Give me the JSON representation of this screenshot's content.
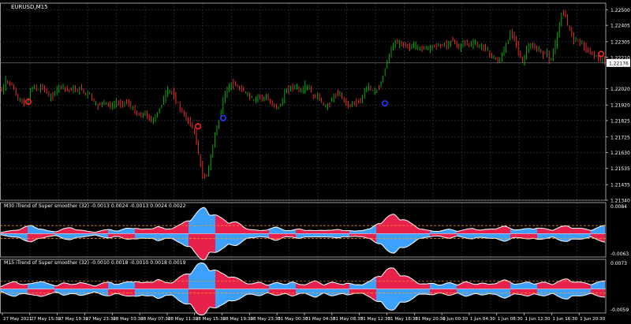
{
  "window": {
    "title": "EURUSD,M15"
  },
  "main_panel": {
    "price_labels": [
      "1.22500",
      "1.22405",
      "1.22305",
      "1.22210",
      "1.22020",
      "1.21920",
      "1.21825",
      "1.21725",
      "1.21630",
      "1.21535",
      "1.21435",
      "1.21340"
    ],
    "current_price": "1.22176",
    "price_range": [
      1.2134,
      1.2254
    ],
    "price_path": [
      [
        0,
        1.2203
      ],
      [
        5,
        1.22
      ],
      [
        10,
        1.2207
      ],
      [
        15,
        1.2205
      ],
      [
        20,
        1.2202
      ],
      [
        25,
        1.2196
      ],
      [
        30,
        1.2194
      ],
      [
        35,
        1.2192
      ],
      [
        40,
        1.2198
      ],
      [
        45,
        1.2205
      ],
      [
        50,
        1.22
      ],
      [
        55,
        1.2204
      ],
      [
        60,
        1.2201
      ],
      [
        65,
        1.2196
      ],
      [
        70,
        1.2198
      ],
      [
        75,
        1.2202
      ],
      [
        80,
        1.2204
      ],
      [
        85,
        1.2202
      ],
      [
        90,
        1.2201
      ],
      [
        95,
        1.2202
      ],
      [
        100,
        1.22
      ],
      [
        105,
        1.2203
      ],
      [
        110,
        1.2198
      ],
      [
        115,
        1.22
      ],
      [
        120,
        1.2195
      ],
      [
        125,
        1.2191
      ],
      [
        130,
        1.2193
      ],
      [
        135,
        1.2194
      ],
      [
        140,
        1.2192
      ],
      [
        145,
        1.2191
      ],
      [
        150,
        1.2194
      ],
      [
        155,
        1.2192
      ],
      [
        160,
        1.2194
      ],
      [
        165,
        1.2193
      ],
      [
        170,
        1.219
      ],
      [
        175,
        1.2187
      ],
      [
        180,
        1.2185
      ],
      [
        185,
        1.2187
      ],
      [
        190,
        1.2185
      ],
      [
        195,
        1.2182
      ],
      [
        200,
        1.2185
      ],
      [
        205,
        1.219
      ],
      [
        210,
        1.2196
      ],
      [
        215,
        1.2201
      ],
      [
        220,
        1.22
      ],
      [
        225,
        1.2195
      ],
      [
        230,
        1.2191
      ],
      [
        235,
        1.2186
      ],
      [
        240,
        1.2183
      ],
      [
        245,
        1.218
      ],
      [
        250,
        1.2174
      ],
      [
        255,
        1.216
      ],
      [
        260,
        1.2147
      ],
      [
        265,
        1.215
      ],
      [
        270,
        1.216
      ],
      [
        275,
        1.2175
      ],
      [
        280,
        1.2182
      ],
      [
        285,
        1.2194
      ],
      [
        290,
        1.2201
      ],
      [
        295,
        1.2205
      ],
      [
        300,
        1.2204
      ],
      [
        305,
        1.2202
      ],
      [
        310,
        1.2201
      ],
      [
        315,
        1.2199
      ],
      [
        320,
        1.2197
      ],
      [
        325,
        1.2194
      ],
      [
        330,
        1.2198
      ],
      [
        335,
        1.2196
      ],
      [
        340,
        1.2197
      ],
      [
        345,
        1.2193
      ],
      [
        350,
        1.2192
      ],
      [
        355,
        1.219
      ],
      [
        360,
        1.2194
      ],
      [
        365,
        1.2201
      ],
      [
        370,
        1.2202
      ],
      [
        375,
        1.2204
      ],
      [
        380,
        1.2202
      ],
      [
        385,
        1.22
      ],
      [
        390,
        1.2204
      ],
      [
        395,
        1.2202
      ],
      [
        400,
        1.2196
      ],
      [
        405,
        1.2198
      ],
      [
        410,
        1.2194
      ],
      [
        415,
        1.219
      ],
      [
        420,
        1.2193
      ],
      [
        425,
        1.2197
      ],
      [
        430,
        1.2199
      ],
      [
        435,
        1.2198
      ],
      [
        440,
        1.2194
      ],
      [
        445,
        1.2191
      ],
      [
        450,
        1.2194
      ],
      [
        455,
        1.2193
      ],
      [
        460,
        1.2194
      ],
      [
        465,
        1.2201
      ],
      [
        470,
        1.2204
      ],
      [
        475,
        1.22
      ],
      [
        480,
        1.2201
      ],
      [
        485,
        1.2204
      ],
      [
        490,
        1.2213
      ],
      [
        495,
        1.2221
      ],
      [
        500,
        1.2228
      ],
      [
        505,
        1.223
      ],
      [
        510,
        1.2229
      ],
      [
        515,
        1.2229
      ],
      [
        520,
        1.2227
      ],
      [
        525,
        1.2228
      ],
      [
        530,
        1.2228
      ],
      [
        535,
        1.2226
      ],
      [
        540,
        1.2227
      ],
      [
        545,
        1.2227
      ],
      [
        550,
        1.2227
      ],
      [
        555,
        1.2229
      ],
      [
        560,
        1.2227
      ],
      [
        565,
        1.223
      ],
      [
        570,
        1.2227
      ],
      [
        575,
        1.2232
      ],
      [
        580,
        1.223
      ],
      [
        585,
        1.2226
      ],
      [
        590,
        1.2231
      ],
      [
        595,
        1.2229
      ],
      [
        600,
        1.2229
      ],
      [
        605,
        1.223
      ],
      [
        610,
        1.2227
      ],
      [
        615,
        1.2228
      ],
      [
        620,
        1.2225
      ],
      [
        625,
        1.2222
      ],
      [
        630,
        1.222
      ],
      [
        635,
        1.2218
      ],
      [
        640,
        1.2224
      ],
      [
        645,
        1.2229
      ],
      [
        650,
        1.2237
      ],
      [
        655,
        1.2233
      ],
      [
        660,
        1.2224
      ],
      [
        665,
        1.2217
      ],
      [
        670,
        1.2226
      ],
      [
        675,
        1.2229
      ],
      [
        680,
        1.2226
      ],
      [
        685,
        1.2226
      ],
      [
        690,
        1.2222
      ],
      [
        695,
        1.2225
      ],
      [
        700,
        1.2218
      ],
      [
        705,
        1.2226
      ],
      [
        710,
        1.2236
      ],
      [
        715,
        1.2249
      ],
      [
        720,
        1.2245
      ],
      [
        725,
        1.2237
      ],
      [
        730,
        1.2232
      ],
      [
        735,
        1.2232
      ],
      [
        740,
        1.2229
      ],
      [
        745,
        1.2227
      ],
      [
        750,
        1.2224
      ],
      [
        755,
        1.2223
      ],
      [
        760,
        1.2221
      ],
      [
        765,
        1.2219
      ],
      [
        768,
        1.2218
      ]
    ],
    "blue_markers": [
      [
        283,
        1.2184
      ],
      [
        488,
        1.2193
      ]
    ],
    "red_markers": [
      [
        36,
        1.2194
      ],
      [
        251,
        1.2179
      ],
      [
        762,
        1.2223
      ]
    ]
  },
  "indicator_panels": [
    {
      "label": "M30 iTrend of Super smoother (32) -0.0013 0.0024 -0.0013 0.0024 0.0022",
      "axis_labels": [
        "0.0084",
        "-0.0063"
      ],
      "range": [
        -0.0063,
        0.0084
      ],
      "guide_levels": [
        0.0022,
        -0.0013
      ],
      "amplitude_path": [
        [
          0,
          0.0003
        ],
        [
          10,
          0.0006
        ],
        [
          20,
          0.0009
        ],
        [
          30,
          0.0016
        ],
        [
          40,
          0.002
        ],
        [
          50,
          0.0014
        ],
        [
          60,
          0.0007
        ],
        [
          70,
          0.0005
        ],
        [
          80,
          0.0012
        ],
        [
          90,
          0.0015
        ],
        [
          100,
          0.001
        ],
        [
          110,
          0.0006
        ],
        [
          120,
          0.0004
        ],
        [
          130,
          0.0008
        ],
        [
          140,
          0.0011
        ],
        [
          150,
          0.0007
        ],
        [
          160,
          0.0013
        ],
        [
          170,
          0.0016
        ],
        [
          180,
          0.001
        ],
        [
          190,
          0.0013
        ],
        [
          200,
          0.0018
        ],
        [
          210,
          0.0011
        ],
        [
          220,
          0.0016
        ],
        [
          230,
          0.0023
        ],
        [
          240,
          0.0038
        ],
        [
          250,
          0.0052
        ],
        [
          260,
          0.0067
        ],
        [
          270,
          0.005
        ],
        [
          280,
          0.0038
        ],
        [
          290,
          0.0032
        ],
        [
          300,
          0.0028
        ],
        [
          310,
          0.0016
        ],
        [
          320,
          0.001
        ],
        [
          330,
          0.0007
        ],
        [
          340,
          0.0012
        ],
        [
          350,
          0.0016
        ],
        [
          360,
          0.001
        ],
        [
          370,
          0.0008
        ],
        [
          380,
          0.0012
        ],
        [
          390,
          0.0009
        ],
        [
          400,
          0.0007
        ],
        [
          410,
          0.001
        ],
        [
          420,
          0.0008
        ],
        [
          430,
          0.0011
        ],
        [
          440,
          0.0008
        ],
        [
          450,
          0.0006
        ],
        [
          460,
          0.001
        ],
        [
          470,
          0.0012
        ],
        [
          480,
          0.0028
        ],
        [
          490,
          0.004
        ],
        [
          500,
          0.0048
        ],
        [
          510,
          0.004
        ],
        [
          520,
          0.0026
        ],
        [
          530,
          0.0016
        ],
        [
          540,
          0.0009
        ],
        [
          550,
          0.0006
        ],
        [
          560,
          0.0008
        ],
        [
          570,
          0.0011
        ],
        [
          580,
          0.0007
        ],
        [
          590,
          0.001
        ],
        [
          600,
          0.0014
        ],
        [
          610,
          0.0009
        ],
        [
          620,
          0.0011
        ],
        [
          630,
          0.0015
        ],
        [
          640,
          0.0018
        ],
        [
          650,
          0.0012
        ],
        [
          660,
          0.001
        ],
        [
          670,
          0.0013
        ],
        [
          680,
          0.0015
        ],
        [
          690,
          0.0012
        ],
        [
          700,
          0.001
        ],
        [
          710,
          0.0016
        ],
        [
          720,
          0.002
        ],
        [
          730,
          0.0014
        ],
        [
          740,
          0.0012
        ],
        [
          750,
          0.001
        ],
        [
          760,
          0.0016
        ],
        [
          768,
          0.0022
        ]
      ]
    },
    {
      "label": "M15 iTrend of Super smoother (32) -0.0010 0.0018 -0.0010 0.0018 0.0019",
      "axis_labels": [
        "0.0073",
        "-0.0059"
      ],
      "range": [
        -0.0059,
        0.0073
      ],
      "guide_levels": [
        0.0019,
        -0.001
      ],
      "amplitude_path": [
        [
          0,
          0.0006
        ],
        [
          10,
          0.0012
        ],
        [
          20,
          0.0018
        ],
        [
          30,
          0.001
        ],
        [
          40,
          0.0012
        ],
        [
          50,
          0.002
        ],
        [
          60,
          0.0012
        ],
        [
          70,
          0.0008
        ],
        [
          80,
          0.0014
        ],
        [
          90,
          0.001
        ],
        [
          100,
          0.0016
        ],
        [
          110,
          0.0011
        ],
        [
          120,
          0.0008
        ],
        [
          130,
          0.0013
        ],
        [
          140,
          0.0016
        ],
        [
          150,
          0.0011
        ],
        [
          160,
          0.0015
        ],
        [
          170,
          0.002
        ],
        [
          180,
          0.0013
        ],
        [
          190,
          0.0017
        ],
        [
          200,
          0.0022
        ],
        [
          210,
          0.0014
        ],
        [
          220,
          0.0018
        ],
        [
          230,
          0.0028
        ],
        [
          240,
          0.004
        ],
        [
          250,
          0.0054
        ],
        [
          260,
          0.0058
        ],
        [
          270,
          0.0046
        ],
        [
          280,
          0.0035
        ],
        [
          290,
          0.0033
        ],
        [
          300,
          0.0024
        ],
        [
          310,
          0.0016
        ],
        [
          320,
          0.0012
        ],
        [
          330,
          0.0015
        ],
        [
          340,
          0.001
        ],
        [
          350,
          0.0014
        ],
        [
          360,
          0.0012
        ],
        [
          370,
          0.0016
        ],
        [
          380,
          0.001
        ],
        [
          390,
          0.0013
        ],
        [
          400,
          0.0018
        ],
        [
          410,
          0.0011
        ],
        [
          420,
          0.0015
        ],
        [
          430,
          0.0012
        ],
        [
          440,
          0.0014
        ],
        [
          450,
          0.0009
        ],
        [
          460,
          0.0012
        ],
        [
          470,
          0.0018
        ],
        [
          480,
          0.0032
        ],
        [
          490,
          0.0044
        ],
        [
          500,
          0.0046
        ],
        [
          510,
          0.0034
        ],
        [
          520,
          0.0024
        ],
        [
          530,
          0.0015
        ],
        [
          540,
          0.0011
        ],
        [
          550,
          0.0013
        ],
        [
          560,
          0.001
        ],
        [
          570,
          0.0014
        ],
        [
          580,
          0.0011
        ],
        [
          590,
          0.0016
        ],
        [
          600,
          0.0012
        ],
        [
          610,
          0.0014
        ],
        [
          620,
          0.001
        ],
        [
          630,
          0.0016
        ],
        [
          640,
          0.002
        ],
        [
          650,
          0.0014
        ],
        [
          660,
          0.0012
        ],
        [
          670,
          0.0016
        ],
        [
          680,
          0.0013
        ],
        [
          690,
          0.0015
        ],
        [
          700,
          0.0012
        ],
        [
          710,
          0.0018
        ],
        [
          720,
          0.0024
        ],
        [
          730,
          0.0016
        ],
        [
          740,
          0.0014
        ],
        [
          750,
          0.0012
        ],
        [
          760,
          0.0016
        ],
        [
          768,
          0.0019
        ]
      ]
    }
  ],
  "time_axis": {
    "labels": [
      "27 May 2021",
      "27 May 15:30",
      "27 May 19:30",
      "27 May 23:30",
      "28 May 03:30",
      "28 May 07:30",
      "28 May 11:30",
      "28 May 15:30",
      "28 May 19:30",
      "28 May 23:30",
      "31 May 00:30",
      "31 May 04:30",
      "31 May 08:30",
      "31 May 12:30",
      "31 May 16:30",
      "31 May 20:30",
      "1 Jun 00:30",
      "1 Jun 04:30",
      "1 Jun 08:30",
      "1 Jun 12:30",
      "1 Jun 16:30",
      "1 Jun 20:30"
    ]
  },
  "colors": {
    "background": "#000000",
    "grid": "#3a3a5a",
    "axis_text": "#ffffff",
    "bull_candle": "#00c000",
    "bear_candle": "#ff3030",
    "indicator_blue": "#3ca0ff",
    "indicator_red": "#e8204c",
    "indicator_outline": "#ffffff",
    "guide_line": "#ff9a1a",
    "marker_blue": "#1a3cff",
    "marker_red": "#ff2020",
    "separator": "#c0c0c0"
  }
}
